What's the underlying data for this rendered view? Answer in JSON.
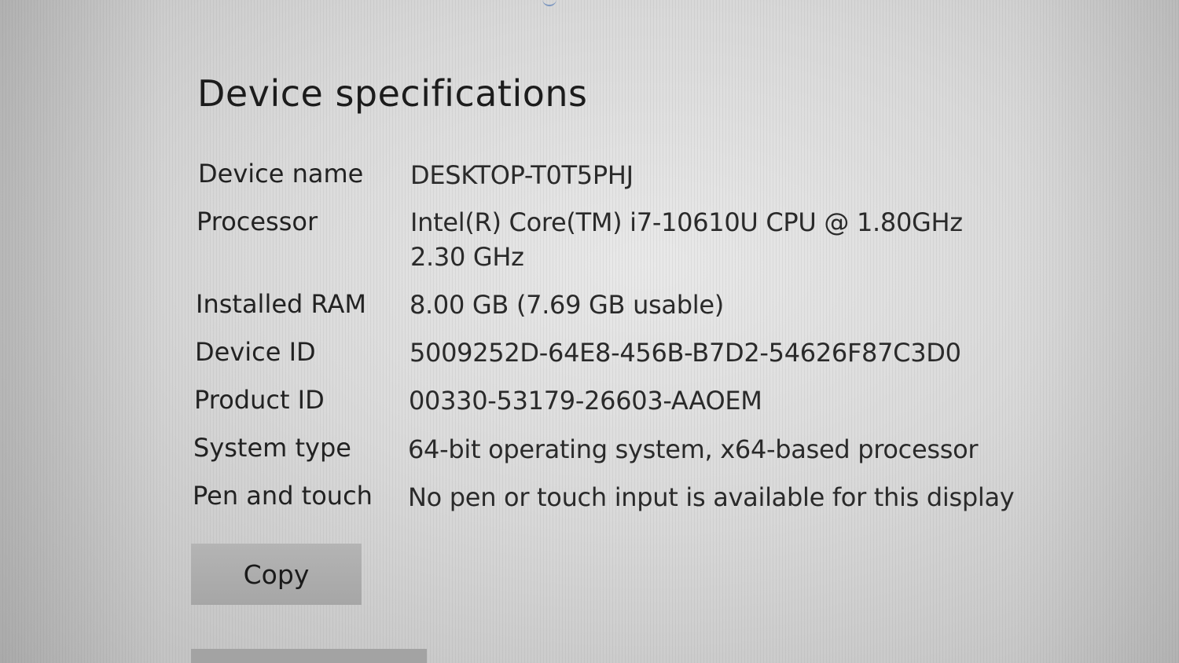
{
  "section": {
    "title": "Device specifications"
  },
  "specs": [
    {
      "label": "Device name",
      "value": "DESKTOP-T0T5PHJ"
    },
    {
      "label": "Processor",
      "value": "Intel(R) Core(TM) i7-10610U CPU @ 1.80GHz   2.30 GHz"
    },
    {
      "label": "Installed RAM",
      "value": "8.00 GB (7.69 GB usable)"
    },
    {
      "label": "Device ID",
      "value": "5009252D-64E8-456B-B7D2-54626F87C3D0"
    },
    {
      "label": "Product ID",
      "value": "00330-53179-26603-AAOEM"
    },
    {
      "label": "System type",
      "value": "64-bit operating system, x64-based processor"
    },
    {
      "label": "Pen and touch",
      "value": "No pen or touch input is available for this display"
    }
  ],
  "actions": {
    "copy_label": "Copy"
  }
}
